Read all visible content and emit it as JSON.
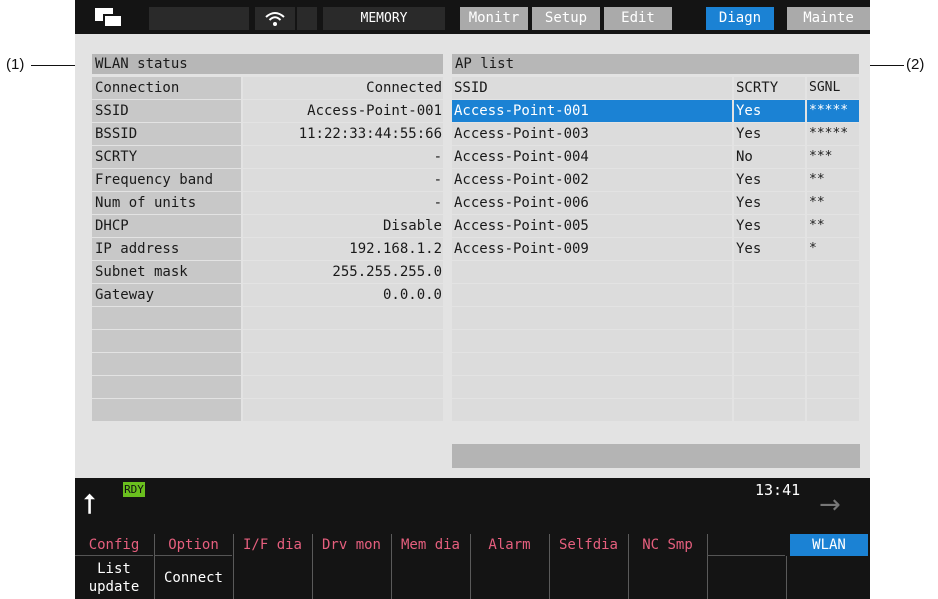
{
  "callouts": {
    "left": "(1)",
    "right": "(2)"
  },
  "topbar": {
    "mode": "MEMORY",
    "tabs": [
      "Monitr",
      "Setup",
      "Edit",
      "Diagn",
      "Mainte"
    ],
    "active_tab": "Diagn"
  },
  "wlan_status": {
    "title": "WLAN status",
    "rows": [
      {
        "label": "Connection",
        "value": "Connected"
      },
      {
        "label": "SSID",
        "value": "Access-Point-001"
      },
      {
        "label": "BSSID",
        "value": "11:22:33:44:55:66"
      },
      {
        "label": "SCRTY",
        "value": "-"
      },
      {
        "label": "Frequency band",
        "value": "-"
      },
      {
        "label": "Num of units",
        "value": "-"
      },
      {
        "label": "DHCP",
        "value": "Disable"
      },
      {
        "label": "IP address",
        "value": "192.168.1.2"
      },
      {
        "label": "Subnet mask",
        "value": "255.255.255.0"
      },
      {
        "label": "Gateway",
        "value": "0.0.0.0"
      }
    ]
  },
  "ap_list": {
    "title": "AP list",
    "headers": {
      "ssid": "SSID",
      "scrty": "SCRTY",
      "sgnl": "SGNL"
    },
    "rows": [
      {
        "ssid": "Access-Point-001",
        "scrty": "Yes",
        "sgnl": "*****"
      },
      {
        "ssid": "Access-Point-003",
        "scrty": "Yes",
        "sgnl": "*****"
      },
      {
        "ssid": "Access-Point-004",
        "scrty": "No",
        "sgnl": "***"
      },
      {
        "ssid": "Access-Point-002",
        "scrty": "Yes",
        "sgnl": "**"
      },
      {
        "ssid": "Access-Point-006",
        "scrty": "Yes",
        "sgnl": "**"
      },
      {
        "ssid": "Access-Point-005",
        "scrty": "Yes",
        "sgnl": "**"
      },
      {
        "ssid": "Access-Point-009",
        "scrty": "Yes",
        "sgnl": "*"
      }
    ]
  },
  "status": {
    "ready": "RDY",
    "time": "13:41"
  },
  "function_keys": [
    "Config",
    "Option",
    "I/F dia",
    "Drv mon",
    "Mem dia",
    "Alarm",
    "Selfdia",
    "NC Smp",
    "",
    "WLAN"
  ],
  "softkeys": [
    "List\nupdate",
    "Connect"
  ],
  "colors": {
    "accent": "#1b82d4",
    "menu_text": "#e65f7e",
    "ready": "#6abf1e"
  }
}
